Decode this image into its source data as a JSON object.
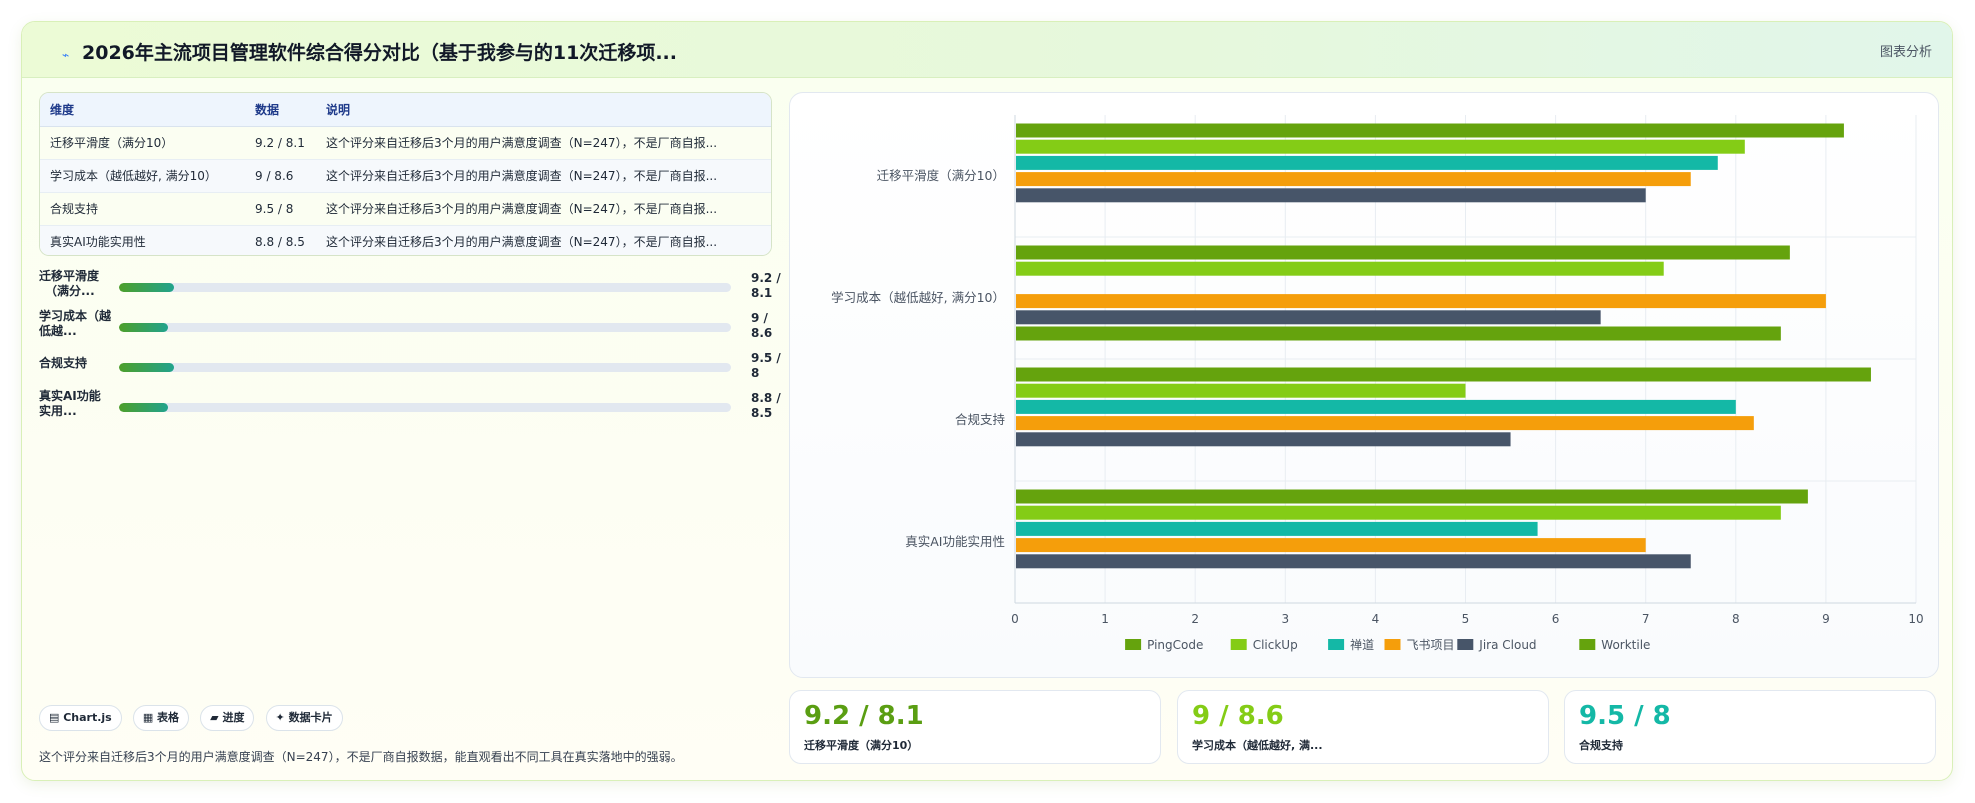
{
  "header": {
    "icon": "chart-line-icon",
    "title": "2026年主流项目管理软件综合得分对比（基于我参与的11次迁移项...",
    "tag": "图表分析"
  },
  "table": {
    "headers": [
      "维度",
      "数据",
      "说明"
    ],
    "rows": [
      {
        "dim": "迁移平滑度（满分10）",
        "data": "9.2 / 8.1",
        "desc": "这个评分来自迁移后3个月的用户满意度调查（N=247），不是厂商自报..."
      },
      {
        "dim": "学习成本（越低越好, 满分10）",
        "data": "9 / 8.6",
        "desc": "这个评分来自迁移后3个月的用户满意度调查（N=247），不是厂商自报..."
      },
      {
        "dim": "合规支持",
        "data": "9.5 / 8",
        "desc": "这个评分来自迁移后3个月的用户满意度调查（N=247），不是厂商自报..."
      },
      {
        "dim": "真实AI功能实用性",
        "data": "8.8 / 8.5",
        "desc": "这个评分来自迁移后3个月的用户满意度调查（N=247），不是厂商自报..."
      }
    ]
  },
  "progress": [
    {
      "label1": "迁移平滑度",
      "label2": "（满分...",
      "value1": "9.2 /",
      "value2": "8.1",
      "fill": 0.09
    },
    {
      "label1": "学习成本（越",
      "label2": "低越...",
      "value1": "9 /",
      "value2": "8.6",
      "fill": 0.08
    },
    {
      "label1": "合规支持",
      "label2": "",
      "value1": "9.5 /",
      "value2": "8",
      "fill": 0.09
    },
    {
      "label1": "真实AI功能",
      "label2": "实用...",
      "value1": "8.8 /",
      "value2": "8.5",
      "fill": 0.08
    }
  ],
  "chips": [
    "▤ Chart.js",
    "▦ 表格",
    "▰ 进度",
    "✦ 数据卡片"
  ],
  "footnote": "这个评分来自迁移后3个月的用户满意度调查（N=247），不是厂商自报数据，能直观看出不同工具在真实落地中的强弱。",
  "stats": [
    {
      "value": "9.2 / 8.1",
      "label": "迁移平滑度（满分10）",
      "color": "#5a9e12"
    },
    {
      "value": "9 / 8.6",
      "label": "学习成本（越低越好, 满...",
      "color": "#84cc16"
    },
    {
      "value": "9.5 / 8",
      "label": "合规支持",
      "color": "#14b8a6"
    }
  ],
  "chart_data": {
    "type": "bar",
    "orientation": "horizontal",
    "categories": [
      "迁移平滑度（满分10）",
      "学习成本（越低越好, 满分10）",
      "合规支持",
      "真实AI功能实用性"
    ],
    "series": [
      {
        "name": "PingCode",
        "color": "#65a30d",
        "values": [
          9.2,
          8.6,
          9.5,
          8.8
        ]
      },
      {
        "name": "ClickUp",
        "color": "#84cc16",
        "values": [
          8.1,
          7.2,
          5.0,
          8.5
        ]
      },
      {
        "name": "禅道",
        "color": "#14b8a6",
        "values": [
          7.8,
          null,
          8.0,
          5.8
        ]
      },
      {
        "name": "飞书项目",
        "color": "#f59e0b",
        "values": [
          7.5,
          9.0,
          8.2,
          7.0
        ]
      },
      {
        "name": "Jira Cloud",
        "color": "#475569",
        "values": [
          7.0,
          6.5,
          5.5,
          7.5
        ]
      },
      {
        "name": "Worktile",
        "color": "#65a30d",
        "values": [
          null,
          8.5,
          null,
          null
        ]
      }
    ],
    "xlim": [
      0,
      10
    ],
    "xticks": [
      "0",
      "1",
      "2",
      "3",
      "4",
      "5",
      "6",
      "7",
      "8",
      "9",
      "10"
    ],
    "grid": true,
    "legend": "bottom"
  }
}
